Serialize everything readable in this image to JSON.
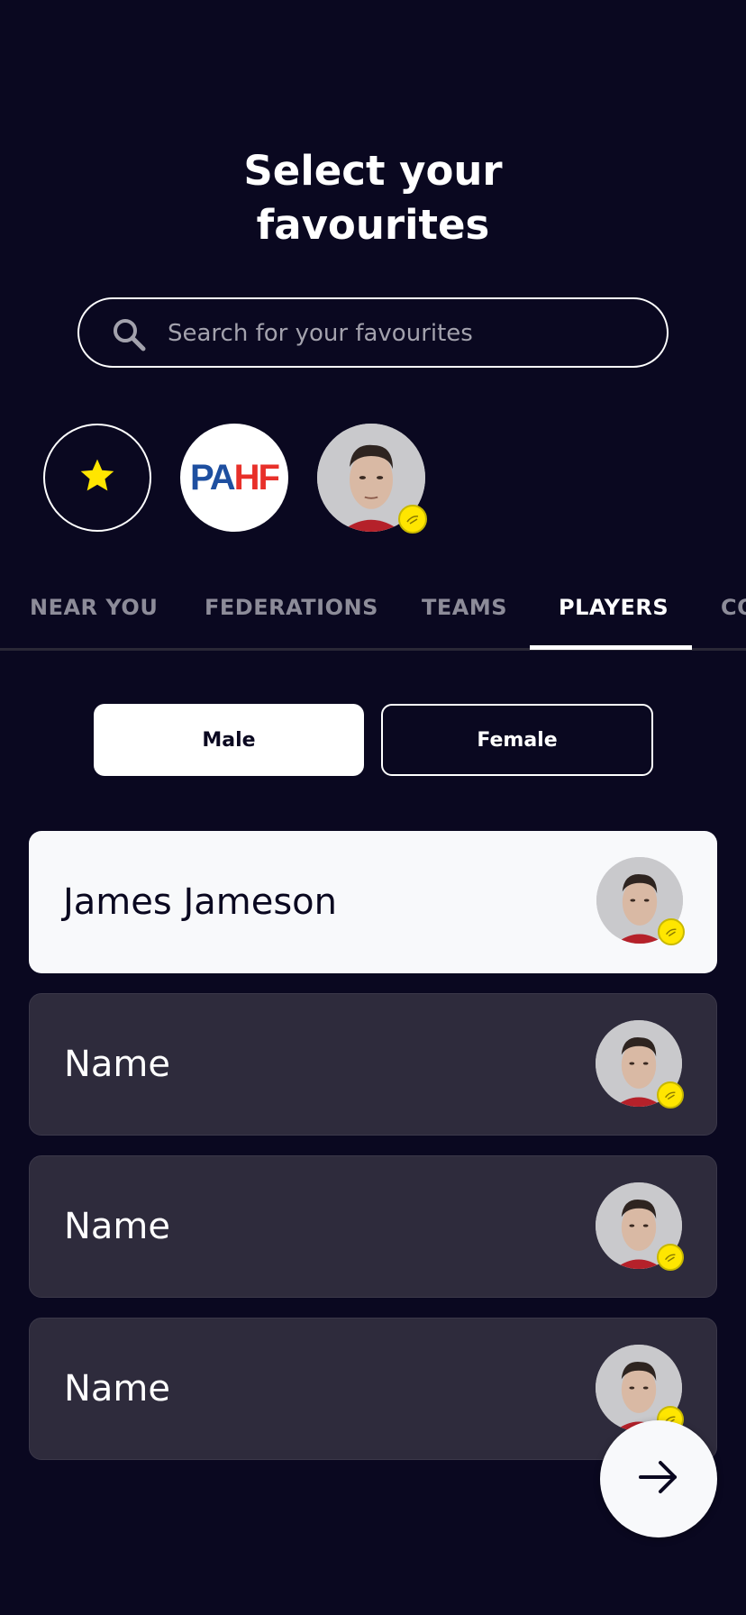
{
  "header": {
    "title_line1": "Select your",
    "title_line2": "favourites"
  },
  "search": {
    "placeholder": "Search for your favourites",
    "icon": "search-icon"
  },
  "favourites": [
    {
      "name": "star",
      "icon": "star-icon",
      "color": "#ffe600"
    },
    {
      "name": "PAHF",
      "logo_pa": "PA",
      "logo_hf": "HF",
      "colors": [
        "#1e4fa0",
        "#e8302a"
      ]
    },
    {
      "name": "player",
      "icon": "player-avatar"
    }
  ],
  "tabs": [
    {
      "label": "NEAR YOU"
    },
    {
      "label": "FEDERATIONS"
    },
    {
      "label": "TEAMS"
    },
    {
      "label": "PLAYERS",
      "active": true
    },
    {
      "label": "CO"
    }
  ],
  "gender_filter": {
    "male": "Male",
    "female": "Female",
    "selected": "Male"
  },
  "players": [
    {
      "name": "James Jameson",
      "selected": true
    },
    {
      "name": "Name",
      "selected": false
    },
    {
      "name": "Name",
      "selected": false
    },
    {
      "name": "Name",
      "selected": false
    }
  ],
  "next_button": {
    "icon": "arrow-right-icon"
  },
  "colors": {
    "background": "#0a0820",
    "badge": "#ffe600",
    "card_unselected": "#2e2b3c",
    "card_selected": "#f8f9fb"
  }
}
